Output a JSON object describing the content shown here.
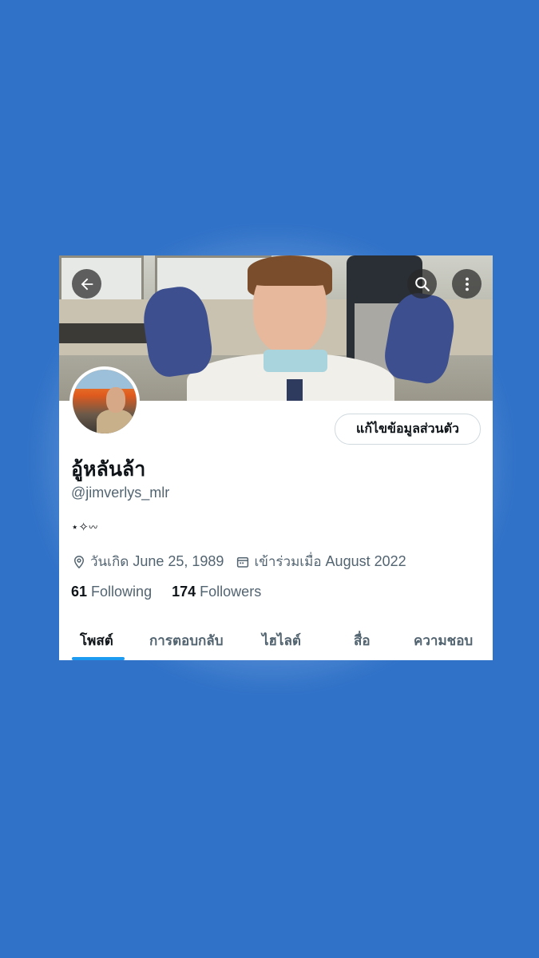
{
  "profile": {
    "display_name": "อู้หลันล้า",
    "handle": "@jimverlys_mlr",
    "bio": "⋆✧𖥦",
    "birthday_label": "วันเกิด",
    "birthday_value": "June 25, 1989",
    "joined_label": "เข้าร่วมเมื่อ",
    "joined_value": "August 2022",
    "following_count": "61",
    "following_label": "Following",
    "followers_count": "174",
    "followers_label": "Followers"
  },
  "actions": {
    "edit_profile_label": "แก้ไขข้อมูลส่วนตัว"
  },
  "tabs": [
    {
      "label": "โพสต์",
      "active": true
    },
    {
      "label": "การตอบกลับ",
      "active": false
    },
    {
      "label": "ไฮไลต์",
      "active": false
    },
    {
      "label": "สื่อ",
      "active": false
    },
    {
      "label": "ความชอบ",
      "active": false
    }
  ],
  "icons": [
    "back-arrow-icon",
    "search-icon",
    "more-options-icon",
    "location-pin-icon",
    "calendar-icon"
  ],
  "colors": {
    "background": "#3072c8",
    "accent": "#1d9bf0",
    "text_primary": "#0f1419",
    "text_secondary": "#536471"
  }
}
